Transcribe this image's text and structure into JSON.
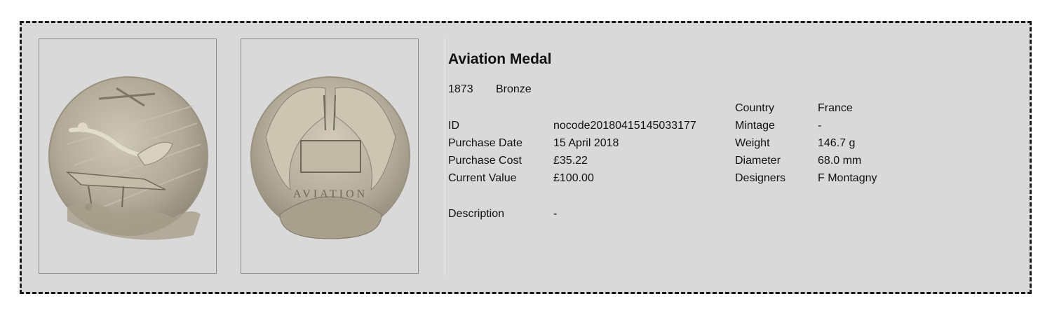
{
  "item": {
    "title": "Aviation Medal",
    "year": "1873",
    "material": "Bronze"
  },
  "details_left": [
    {
      "label": "ID",
      "value": "nocode20180415145033177"
    },
    {
      "label": "Purchase Date",
      "value": "15 April 2018"
    },
    {
      "label": "Purchase Cost",
      "value": "£35.22"
    },
    {
      "label": "Current Value",
      "value": "£100.00"
    }
  ],
  "description": {
    "label": "Description",
    "value": "-"
  },
  "details_right": [
    {
      "label": "Country",
      "value": "France"
    },
    {
      "label": "Mintage",
      "value": "-"
    },
    {
      "label": "Weight",
      "value": "146.7 g"
    },
    {
      "label": "Diameter",
      "value": "68.0 mm"
    },
    {
      "label": "Designers",
      "value": "F Montagny"
    }
  ],
  "images": {
    "obverse": {
      "icon": "medal-obverse-image"
    },
    "reverse": {
      "icon": "medal-reverse-image",
      "inscription": "AVIATION"
    }
  },
  "colors": {
    "panel": "#d9d9d9",
    "border": "#1a1a1a",
    "frame": "#8a8a8a",
    "medal": "#b3aa98"
  }
}
